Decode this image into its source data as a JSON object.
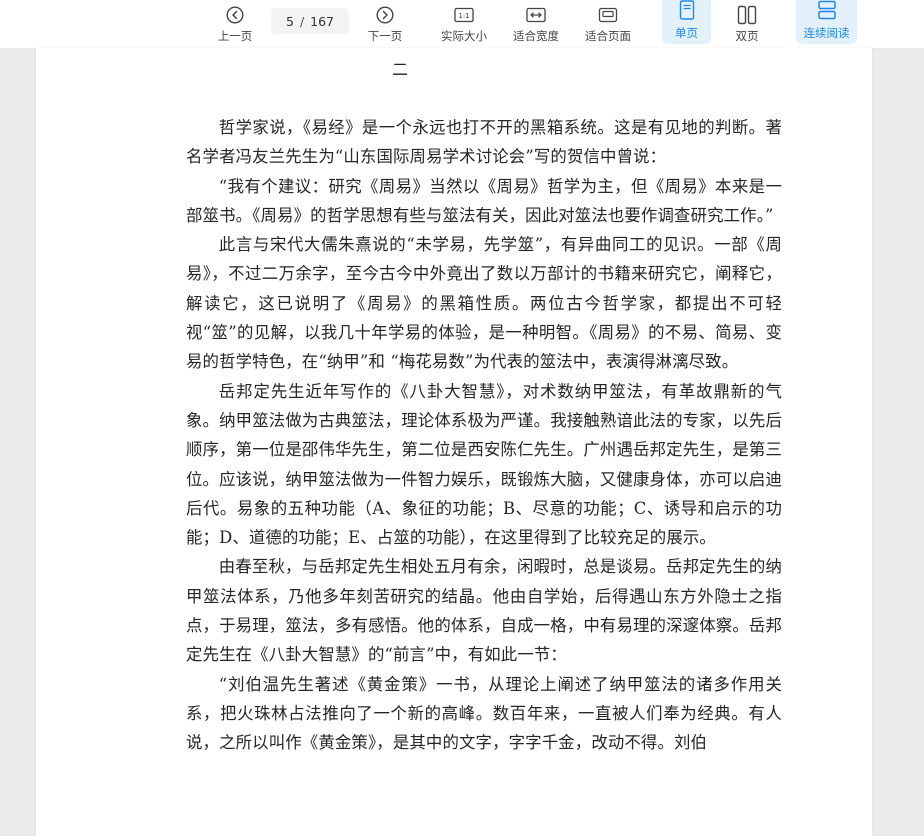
{
  "toolbar": {
    "prev_label": "上一页",
    "current_page": "5",
    "page_separator": "/",
    "total_pages": "167",
    "next_label": "下一页",
    "actual_size_label": "实际大小",
    "actual_size_icon_text": "1:1",
    "fit_width_label": "适合宽度",
    "fit_page_label": "适合页面",
    "single_page_label": "单页",
    "double_page_label": "双页",
    "continuous_label": "连续阅读",
    "active_color": "#1e88e5"
  },
  "document": {
    "heading": "二",
    "paragraphs": [
      "哲学家说，《易经》是一个永远也打不开的黑箱系统。这是有见地的判断。著名学者冯友兰先生为“山东国际周易学术讨论会”写的贺信中曾说：",
      "“我有个建议：研究《周易》当然以《周易》哲学为主，但《周易》本来是一部筮书。《周易》的哲学思想有些与筮法有关，因此对筮法也要作调查研究工作。”",
      "此言与宋代大儒朱熹说的“未学易，先学筮”，有异曲同工的见识。一部《周易》，不过二万余字，至今古今中外竟出了数以万部计的书籍来研究它，阐释它，解读它，这已说明了《周易》的黑箱性质。两位古今哲学家，都提出不可轻视“筮”的见解，以我几十年学易的体验，是一种明智。《周易》的不易、简易、变易的哲学特色，在“纳甲”和 “梅花易数”为代表的筮法中，表演得淋漓尽致。",
      "岳邦定先生近年写作的《八卦大智慧》，对术数纳甲筮法，有革故鼎新的气象。纳甲筮法做为古典筮法，理论体系极为严谨。我接触熟谙此法的专家，以先后顺序，第一位是邵伟华先生，第二位是西安陈仁先生。广州遇岳邦定先生，是第三位。应该说，纳甲筮法做为一件智力娱乐，既锻炼大脑，又健康身体，亦可以启迪后代。易象的五种功能（A、象征的功能；B、尽意的功能；C、诱导和启示的功能；D、道德的功能；E、占筮的功能），在这里得到了比较充足的展示。",
      "由春至秋，与岳邦定先生相处五月有余，闲暇时，总是谈易。岳邦定先生的纳甲筮法体系，乃他多年刻苦研究的结晶。他由自学始，后得遇山东方外隐士之指点，于易理，筮法，多有感悟。他的体系，自成一格，中有易理的深邃体察。岳邦定先生在《八卦大智慧》的“前言”中，有如此一节：",
      "“刘伯温先生著述《黄金策》一书，从理论上阐述了纳甲筮法的诸多作用关系，把火珠林占法推向了一个新的高峰。数百年来，一直被人们奉为经典。有人说，之所以叫作《黄金策》，是其中的文字，字字千金，改动不得。刘伯"
    ]
  }
}
